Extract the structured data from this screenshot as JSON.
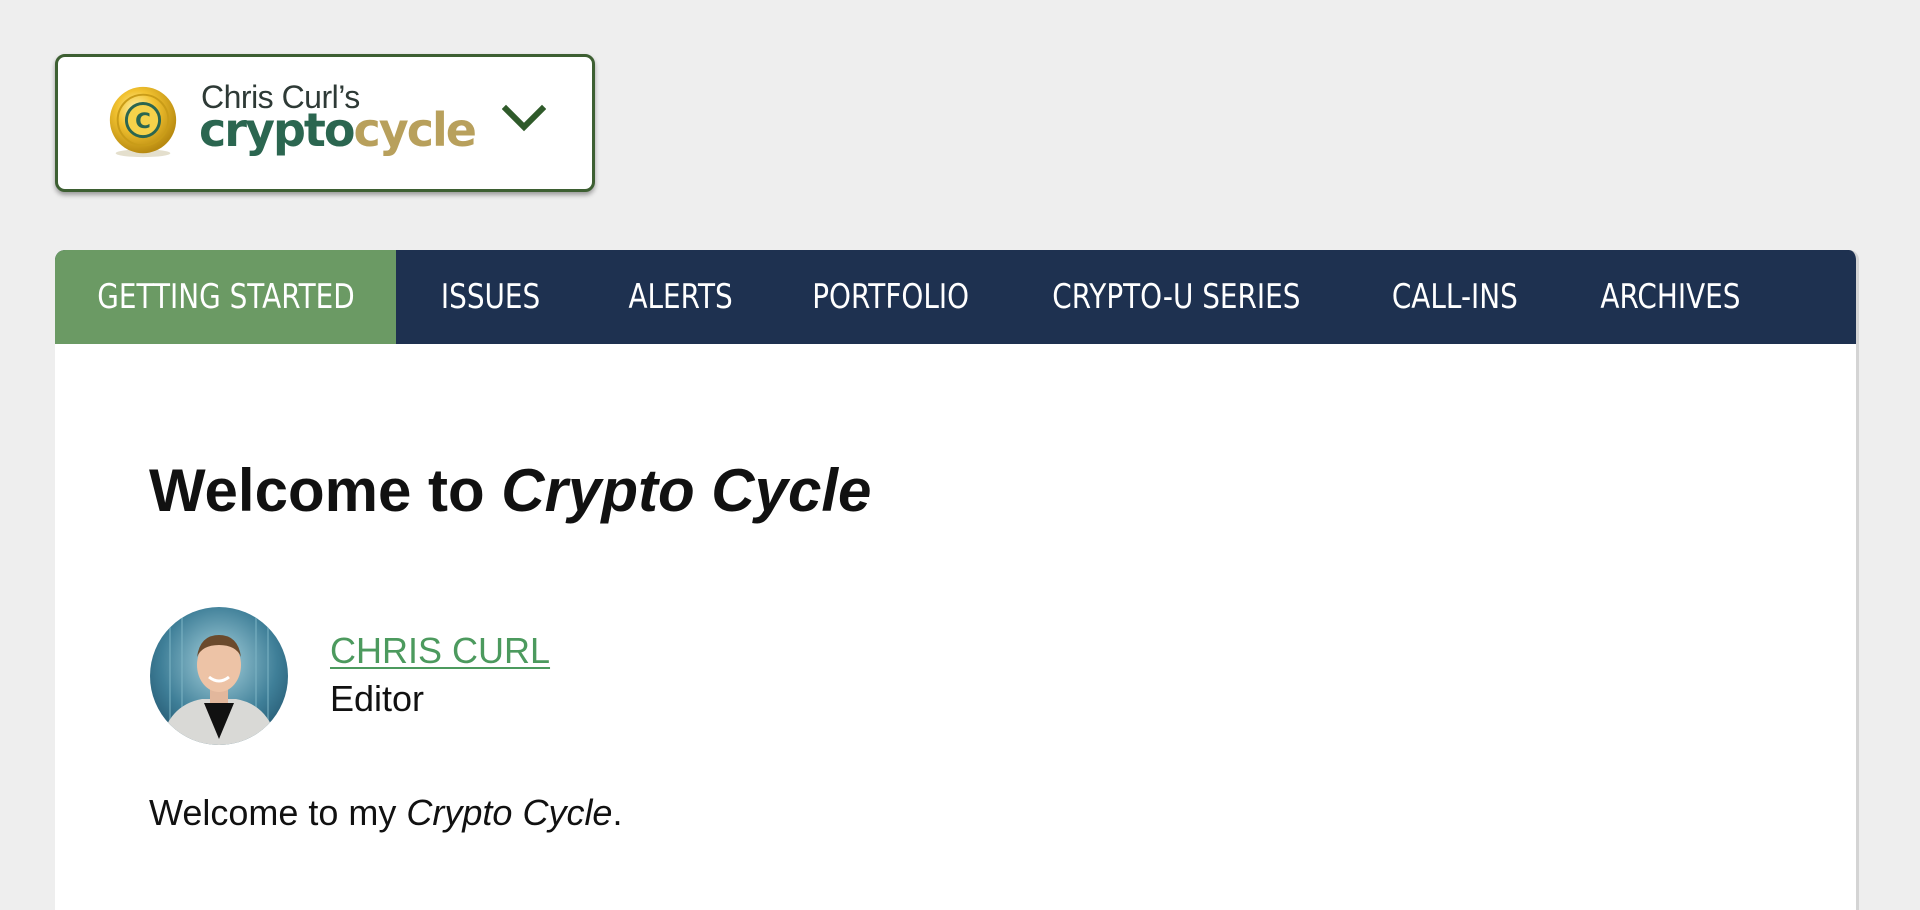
{
  "logo": {
    "top_line": "Chris Curl’s",
    "brand_part1": "crypto",
    "brand_part2": "cycle",
    "icon": "coin-logo-icon",
    "menu_icon": "chevron-down-icon"
  },
  "colors": {
    "nav_background": "#1e3150",
    "nav_active": "#6b9a64",
    "brand_green": "#2b6650",
    "brand_gold": "#b8a05c",
    "link_green": "#4c9a5e",
    "card_border": "#3d5f32"
  },
  "nav": {
    "items": [
      {
        "label": "GETTING STARTED",
        "active": true
      },
      {
        "label": "ISSUES",
        "active": false
      },
      {
        "label": "ALERTS",
        "active": false
      },
      {
        "label": "PORTFOLIO",
        "active": false
      },
      {
        "label": "CRYPTO-U SERIES",
        "active": false
      },
      {
        "label": "CALL-INS",
        "active": false
      },
      {
        "label": "ARCHIVES",
        "active": false
      }
    ]
  },
  "content": {
    "title_prefix": "Welcome to ",
    "title_emphasis": "Crypto Cycle",
    "author_name": "CHRIS CURL",
    "author_role": "Editor",
    "intro_prefix": "Welcome to my ",
    "intro_emphasis": "Crypto Cycle",
    "intro_suffix": "."
  }
}
